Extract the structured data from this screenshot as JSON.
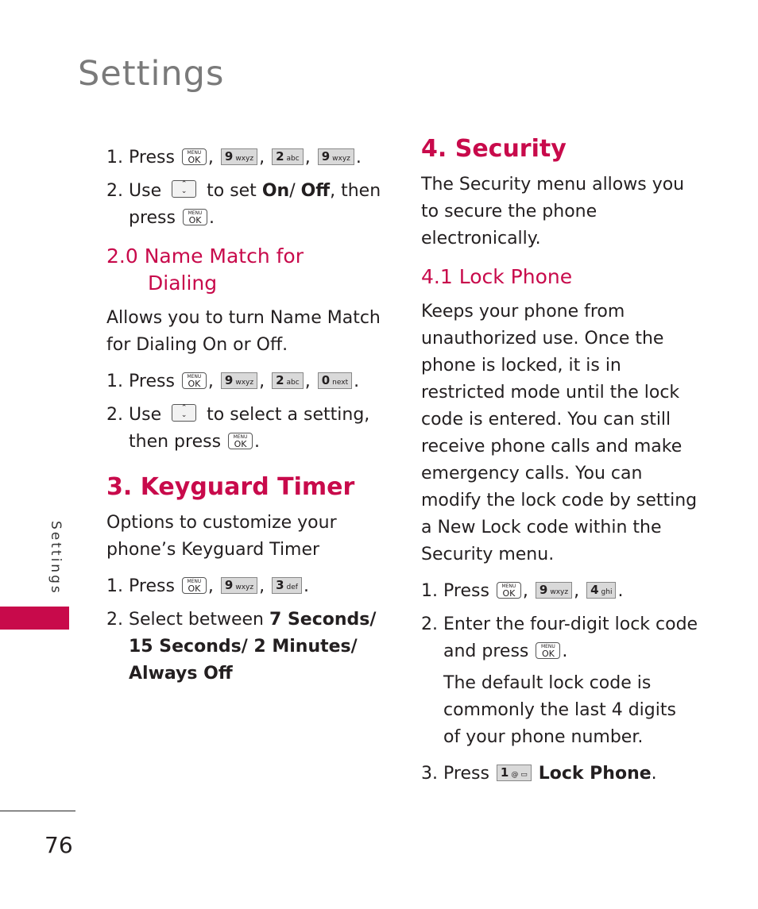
{
  "page": {
    "title": "Settings",
    "side_label": "Settings",
    "page_number": "76",
    "accent_color": "#c80a4b"
  },
  "keys": {
    "menu_ok": {
      "top": "MENU",
      "bottom": "OK"
    },
    "nav": {
      "up": "⌃",
      "down": "⌄"
    },
    "k9": {
      "num": "9",
      "letters": "wxyz"
    },
    "k2": {
      "num": "2",
      "letters": "abc"
    },
    "k0": {
      "num": "0",
      "letters": "next"
    },
    "k3": {
      "num": "3",
      "letters": "def"
    },
    "k4": {
      "num": "4",
      "letters": "ghi"
    },
    "k1": {
      "num": "1",
      "letters": "@ ▭"
    }
  },
  "left": {
    "intro_steps": {
      "s1": {
        "num": "1.",
        "text": "Press",
        "comma": ",",
        "period": "."
      },
      "s2": {
        "num": "2.",
        "pre": "Use",
        "mid": "to set",
        "on": "On",
        "slash": "/ ",
        "off": "Off",
        "post": ", then",
        "line2": "press",
        "period": "."
      }
    },
    "section_2_0": {
      "heading_line1": "2.0 Name Match for",
      "heading_line2": "Dialing",
      "description": "Allows you to turn Name Match for Dialing On or Off.",
      "s1": {
        "num": "1.",
        "text": "Press"
      },
      "s2": {
        "num": "2.",
        "pre": "Use",
        "post": "to select a setting,",
        "line2": "then press"
      }
    },
    "section_3": {
      "heading": "3. Keyguard Timer",
      "description": "Options to customize your phone’s Keyguard Timer",
      "s1": {
        "num": "1.",
        "text": "Press"
      },
      "s2": {
        "num": "2.",
        "pre": "Select between",
        "options": "7 Seconds/ 15 Seconds/ 2 Minutes/ Always Off"
      }
    }
  },
  "right": {
    "section_4": {
      "heading": "4. Security",
      "description": "The Security menu allows you to secure the phone electronically."
    },
    "section_4_1": {
      "heading": "4.1 Lock Phone",
      "description": "Keeps your phone from unauthorized use. Once the phone is locked, it is in restricted mode until the lock code is entered. You can still receive phone calls and make emergency calls. You can modify the lock code by setting a New Lock code within the Security menu.",
      "s1": {
        "num": "1.",
        "text": "Press"
      },
      "s2": {
        "num": "2.",
        "text": "Enter the four-digit lock code and press"
      },
      "note": "The default lock code is commonly the last 4 digits of your phone number.",
      "s3": {
        "num": "3.",
        "text": "Press",
        "target": "Lock Phone"
      }
    }
  }
}
